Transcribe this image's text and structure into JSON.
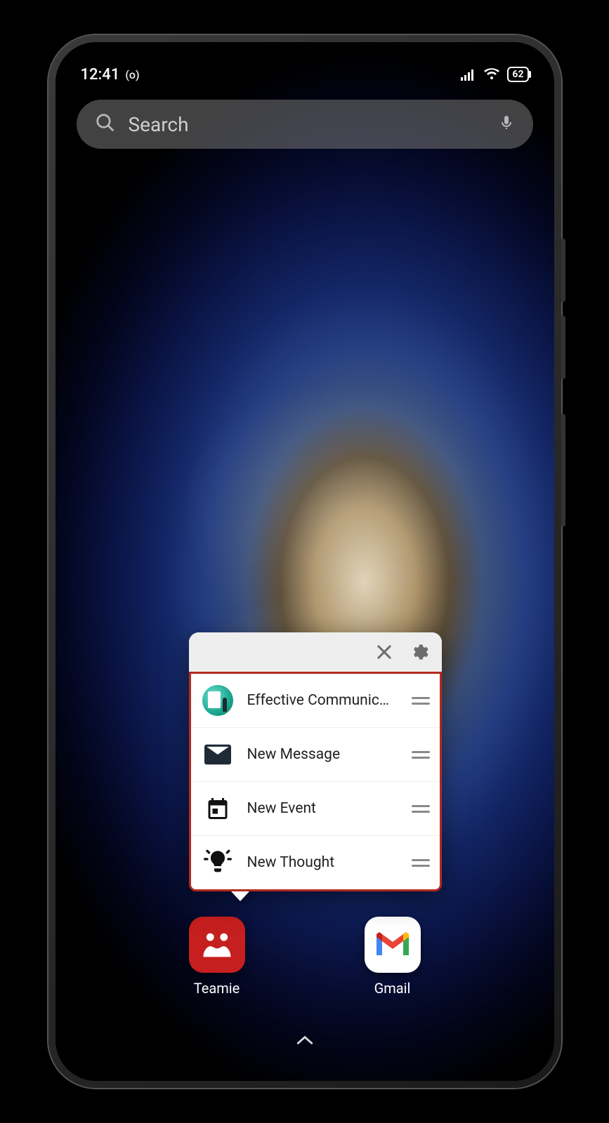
{
  "status": {
    "time": "12:41",
    "recording_indicator": "(o)",
    "battery_text": "62"
  },
  "search": {
    "placeholder": "Search"
  },
  "popup": {
    "items": [
      {
        "label": "Effective Communic…",
        "icon": "classroom-avatar"
      },
      {
        "label": "New Message",
        "icon": "mail-icon"
      },
      {
        "label": "New Event",
        "icon": "calendar-icon"
      },
      {
        "label": "New Thought",
        "icon": "lightbulb-icon"
      }
    ]
  },
  "dock": {
    "apps": [
      {
        "name": "Teamie"
      },
      {
        "name": "Gmail"
      }
    ]
  }
}
